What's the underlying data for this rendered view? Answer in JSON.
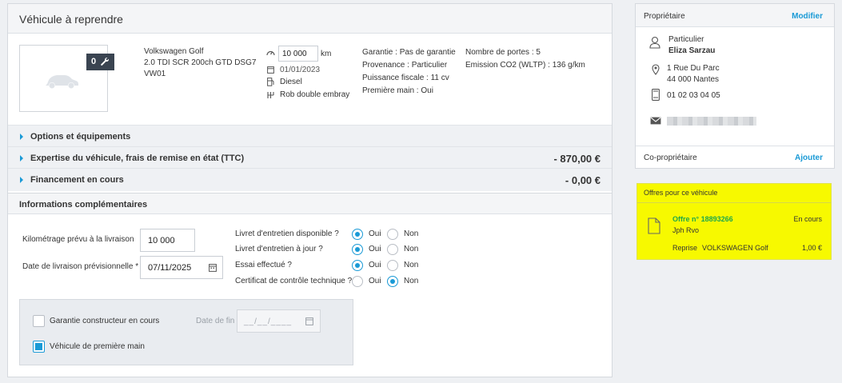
{
  "vehicle": {
    "title": "Véhicule à reprendre",
    "photo_count": "0",
    "make_model": "Volkswagen Golf",
    "version": "2.0 TDI SCR 200ch GTD DSG7",
    "code": "VW01",
    "mileage": "10 000",
    "mileage_unit": "km",
    "registration_date": "01/01/2023",
    "fuel": "Diesel",
    "gearbox": "Rob double embray",
    "warranty": "Garantie : Pas de garantie",
    "origin": "Provenance : Particulier",
    "fiscal_power": "Puissance fiscale : 11 cv",
    "first_hand": "Première main : Oui",
    "doors": "Nombre de portes : 5",
    "co2": "Emission CO2 (WLTP) : 136 g/km"
  },
  "accordions": [
    {
      "label": "Options et équipements",
      "amount": ""
    },
    {
      "label": "Expertise du véhicule, frais de remise en état (TTC)",
      "amount": "- 870,00 €"
    },
    {
      "label": "Financement en cours",
      "amount": "- 0,00 €"
    }
  ],
  "info": {
    "title": "Informations complémentaires",
    "mileage_label": "Kilométrage prévu à la livraison",
    "mileage_value": "10 000",
    "delivery_label": "Date de livraison prévisionnelle",
    "delivery_required": "*",
    "delivery_value": "07/11/2025",
    "questions": [
      {
        "label": "Livret d'entretien disponible ?",
        "yes": "Oui",
        "no": "Non",
        "selected": "yes"
      },
      {
        "label": "Livret d'entretien à jour ?",
        "yes": "Oui",
        "no": "Non",
        "selected": "yes"
      },
      {
        "label": "Essai effectué ?",
        "yes": "Oui",
        "no": "Non",
        "selected": "yes"
      },
      {
        "label": "Certificat de contrôle technique ?",
        "yes": "Oui",
        "no": "Non",
        "selected": "no"
      }
    ],
    "manufacturer_warranty": "Garantie constructeur en cours",
    "end_date_label": "Date de fin",
    "end_date_placeholder": "__/__/____",
    "first_hand_vehicle": "Véhicule de première main"
  },
  "owner": {
    "title": "Propriétaire",
    "modify": "Modifier",
    "type": "Particulier",
    "name": "Eliza Sarzau",
    "address_line1": "1 Rue Du Parc",
    "address_line2": "44 000 Nantes",
    "phone": "01 02 03 04 05",
    "co_owner": "Co-propriétaire",
    "add": "Ajouter"
  },
  "offers": {
    "title": "Offres pour ce véhicule",
    "offer_number": "Offre n° 18893266",
    "status": "En cours",
    "agent": "Jph Rvo",
    "type": "Reprise",
    "vehicle": "VOLKSWAGEN Golf",
    "amount": "1,00 €"
  }
}
